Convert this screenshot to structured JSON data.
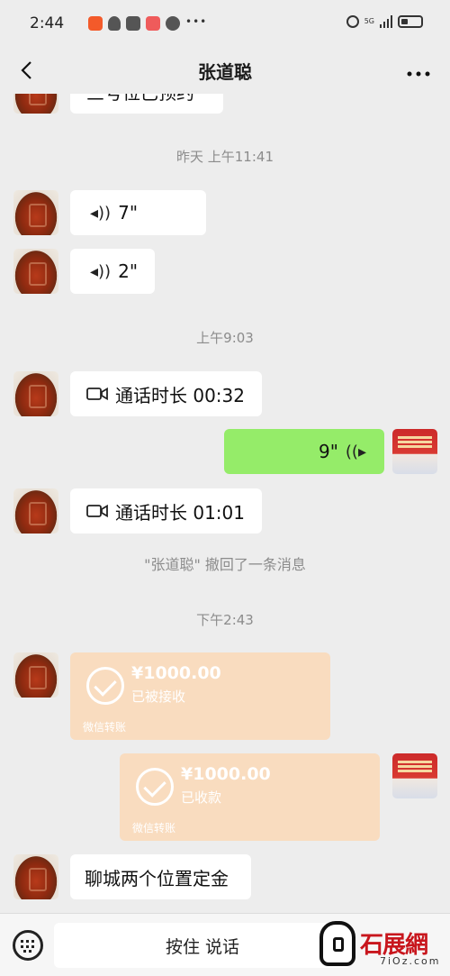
{
  "status_bar": {
    "time": "2:44",
    "network": "5G",
    "icons": [
      "app-icon",
      "heart-icon",
      "shield-icon",
      "mail-icon",
      "wechat-icon",
      "more-icon",
      "alarm-icon",
      "signal-icon",
      "battery-icon"
    ]
  },
  "nav": {
    "title": "张道聪",
    "back_icon": "chevron-left-icon",
    "more_icon": "more-dots-icon"
  },
  "messages": {
    "partial_text": "三号位已预约",
    "ts1": "昨天 上午11:41",
    "voice1": "7\"",
    "voice2": "2\"",
    "ts2": "上午9:03",
    "call1": "通话时长 00:32",
    "voice_sent": "9\"",
    "call2": "通话时长 01:01",
    "recall_notice": "\"张道聪\" 撤回了一条消息",
    "ts3": "下午2:43",
    "transfer1": {
      "amount": "¥1000.00",
      "status": "已被接收",
      "label": "微信转账"
    },
    "transfer2": {
      "amount": "¥1000.00",
      "status": "已收款",
      "label": "微信转账"
    },
    "last_text": "聊城两个位置定金"
  },
  "input_bar": {
    "hold_to_talk": "按住 说话",
    "keyboard_icon": "keyboard-icon",
    "emoji_icon": "emoji-icon"
  },
  "watermark": {
    "title": "石展網",
    "sub": "7iOz.com"
  },
  "colors": {
    "background": "#ededed",
    "sent_bubble": "#95ec69",
    "received_bubble": "#ffffff",
    "transfer_bubble": "#f9dcbf"
  }
}
